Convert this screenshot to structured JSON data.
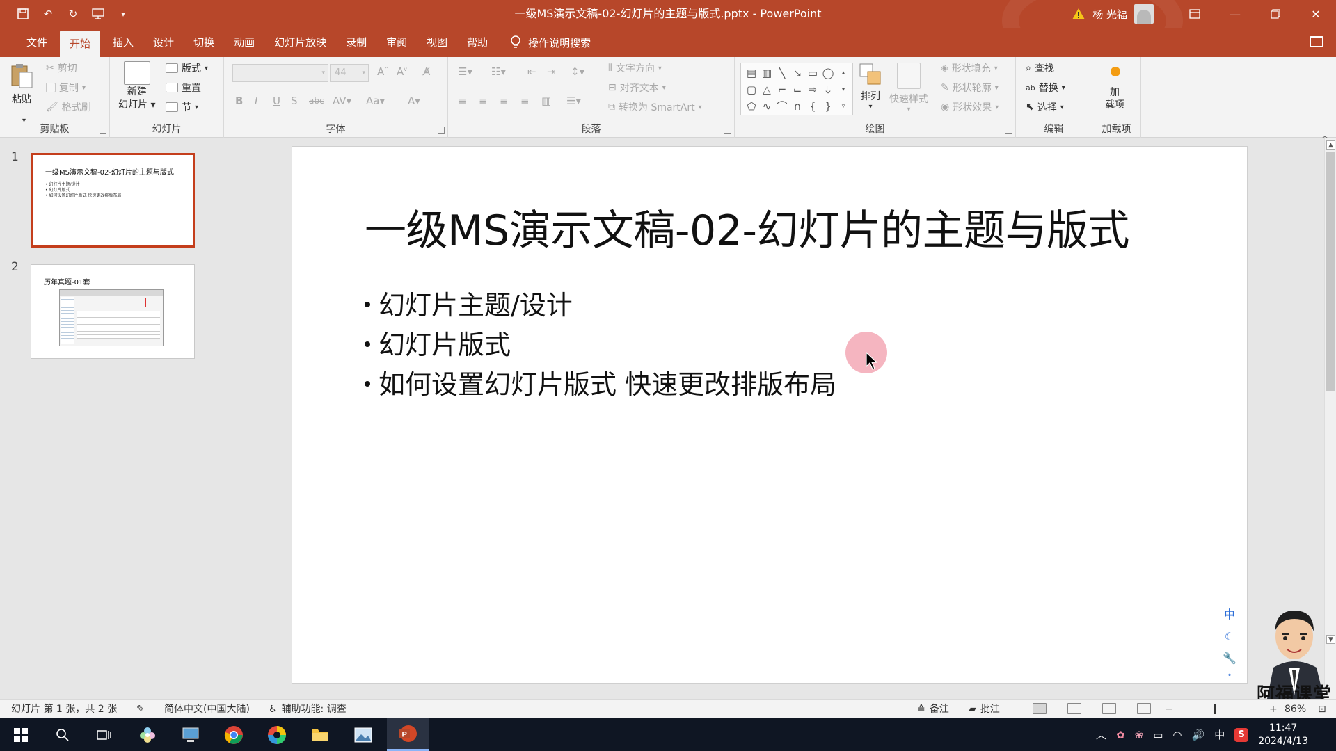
{
  "app": {
    "document_title": "一级MS演示文稿-02-幻灯片的主题与版式.pptx - PowerPoint",
    "username": "杨 光福"
  },
  "tabs": [
    "文件",
    "开始",
    "插入",
    "设计",
    "切换",
    "动画",
    "幻灯片放映",
    "录制",
    "审阅",
    "视图",
    "帮助"
  ],
  "active_tab": "开始",
  "tell_me": "操作说明搜索",
  "ribbon": {
    "clipboard": {
      "label": "剪贴板",
      "paste": "粘贴",
      "cut": "剪切",
      "copy": "复制",
      "format_painter": "格式刷"
    },
    "slides": {
      "label": "幻灯片",
      "new_slide_line1": "新建",
      "new_slide_line2": "幻灯片",
      "layout": "版式",
      "reset": "重置",
      "section": "节"
    },
    "font": {
      "label": "字体",
      "font_name": "",
      "font_size": "44"
    },
    "paragraph": {
      "label": "段落",
      "text_direction": "文字方向",
      "align_text": "对齐文本",
      "convert_smartart": "转换为 SmartArt"
    },
    "drawing": {
      "label": "绘图",
      "arrange": "排列",
      "quick_styles": "快速样式",
      "shape_fill": "形状填充",
      "shape_outline": "形状轮廓",
      "shape_effects": "形状效果"
    },
    "editing": {
      "label": "编辑",
      "find": "查找",
      "replace": "替换",
      "select": "选择"
    },
    "addins": {
      "label": "加载项",
      "btn_line1": "加",
      "btn_line2": "载项"
    }
  },
  "thumbnails": [
    {
      "number": "1",
      "title": "一级MS演示文稿-02-幻灯片的主题与版式",
      "bullets": [
        "• 幻灯片主题/设计",
        "• 幻灯片版式",
        "• 如何设置幻灯片版式 快速更改排版布局"
      ]
    },
    {
      "number": "2",
      "title": "历年真题-01套"
    }
  ],
  "slide": {
    "title": "一级MS演示文稿-02-幻灯片的主题与版式",
    "bullets": [
      "幻灯片主题/设计",
      "幻灯片版式",
      "如何设置幻灯片版式 快速更改排版布局"
    ]
  },
  "ime_toolbar": [
    "中"
  ],
  "watermark_brand": "阿福课堂",
  "statusbar": {
    "slide_info": "幻灯片 第 1 张，共 2 张",
    "language": "简体中文(中国大陆)",
    "accessibility": "辅助功能: 调查",
    "notes": "备注",
    "comments": "批注",
    "zoom": "86%"
  },
  "taskbar": {
    "time": "11:47",
    "date": "2024/4/13",
    "ime": "中"
  },
  "colors": {
    "accent": "#b7472a",
    "selected_thumb_border": "#c43e1c",
    "taskbar": "#0f1623"
  }
}
